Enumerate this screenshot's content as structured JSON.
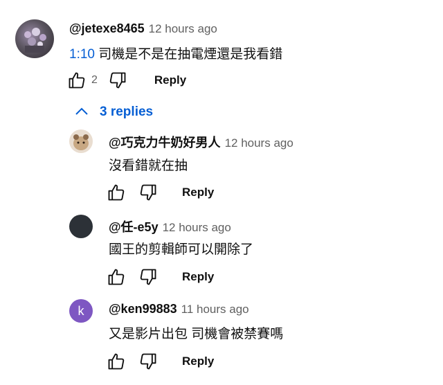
{
  "comment": {
    "author": "@jetexe8465",
    "time": "12 hours ago",
    "timestamp_link": "1:10",
    "text": " 司機是不是在抽電煙還是我看錯",
    "like_count": "2",
    "reply_label": "Reply"
  },
  "replies_toggle": {
    "label": "3 replies",
    "icon": "chevron-up-icon",
    "color": "#065fd4"
  },
  "replies": [
    {
      "author": "@巧克力牛奶好男人",
      "time": "12 hours ago",
      "text": "沒看錯就在抽",
      "reply_label": "Reply"
    },
    {
      "author": "@任-e5y",
      "time": "12 hours ago",
      "text": "國王的剪輯師可以開除了",
      "reply_label": "Reply"
    },
    {
      "author": "@ken99883",
      "time": "11 hours ago",
      "text": "又是影片出包  司機會被禁賽嗎",
      "reply_label": "Reply",
      "avatar_letter": "k",
      "avatar_color": "#7e57c2"
    }
  ]
}
